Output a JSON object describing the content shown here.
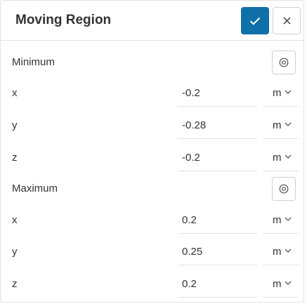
{
  "dialog": {
    "title": "Moving Region",
    "confirm_icon": "check-icon",
    "close_icon": "close-icon"
  },
  "minimum": {
    "label": "Minimum",
    "pick_icon": "pick-point-icon",
    "rows": [
      {
        "axis": "x",
        "value": "-0.2",
        "unit": "m"
      },
      {
        "axis": "y",
        "value": "-0.28",
        "unit": "m"
      },
      {
        "axis": "z",
        "value": "-0.2",
        "unit": "m"
      }
    ]
  },
  "maximum": {
    "label": "Maximum",
    "pick_icon": "pick-point-icon",
    "rows": [
      {
        "axis": "x",
        "value": "0.2",
        "unit": "m"
      },
      {
        "axis": "y",
        "value": "0.25",
        "unit": "m"
      },
      {
        "axis": "z",
        "value": "0.2",
        "unit": "m"
      }
    ]
  },
  "colors": {
    "accent": "#0f6fa8"
  }
}
